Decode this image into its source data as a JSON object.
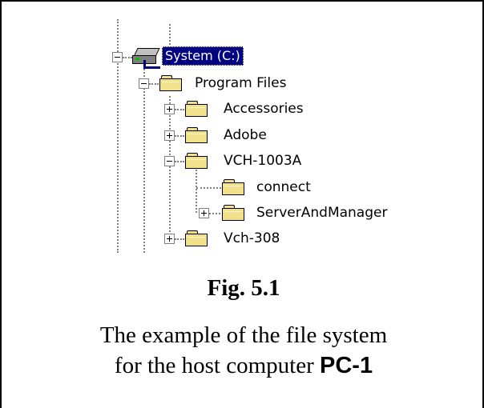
{
  "tree": {
    "root": {
      "label": "System (C:)",
      "icon": "network-drive-icon",
      "selected": true,
      "expanded": true
    },
    "program_files": {
      "label": "Program Files",
      "expanded": true
    },
    "children": [
      {
        "label": "Accessories",
        "toggle": "plus"
      },
      {
        "label": "Adobe",
        "toggle": "plus"
      },
      {
        "label": "VCH-1003A",
        "toggle": "minus"
      },
      {
        "label": "connect",
        "toggle": "none"
      },
      {
        "label": "ServerAndManager",
        "toggle": "plus"
      },
      {
        "label": "Vch-308",
        "toggle": "plus"
      }
    ]
  },
  "caption": {
    "figure": "Fig. 5.1",
    "line1": "The example of the file system",
    "line2_prefix": "for the host computer ",
    "line2_strong": "PC-1"
  },
  "colors": {
    "selection": "#000080",
    "folder": "#f3e08a",
    "connector": "#808080"
  }
}
